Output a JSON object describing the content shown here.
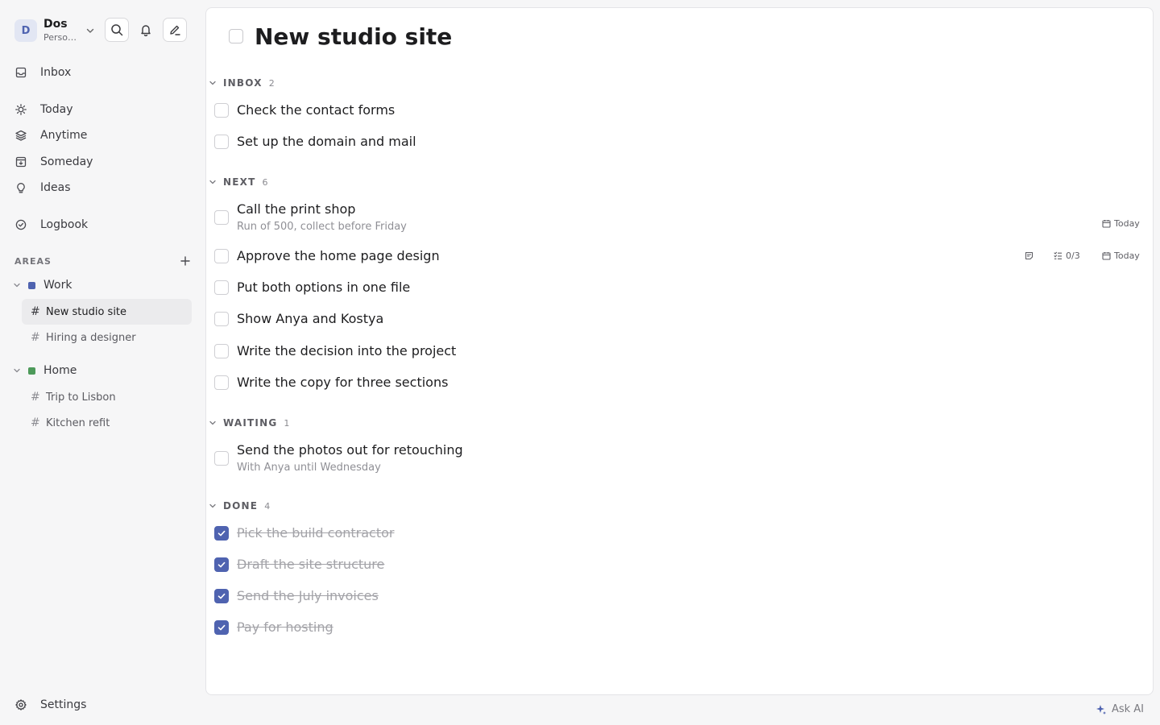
{
  "workspace": {
    "avatar_letter": "D",
    "name": "Dos",
    "subtitle": "Personal"
  },
  "sidebar": {
    "nav": [
      {
        "label": "Inbox",
        "icon": "inbox-icon"
      },
      {
        "label": "Today",
        "icon": "sun-icon"
      },
      {
        "label": "Anytime",
        "icon": "layers-icon"
      },
      {
        "label": "Someday",
        "icon": "archive-box-icon"
      },
      {
        "label": "Ideas",
        "icon": "lightbulb-icon"
      },
      {
        "label": "Logbook",
        "icon": "check-circle-icon"
      }
    ],
    "areas_label": "AREAS",
    "areas": [
      {
        "label": "Work",
        "color": "#4f63b0",
        "projects": [
          {
            "label": "New studio site",
            "active": true
          },
          {
            "label": "Hiring a designer"
          }
        ]
      },
      {
        "label": "Home",
        "color": "#4d9a5a",
        "projects": [
          {
            "label": "Trip to Lisbon"
          },
          {
            "label": "Kitchen refit"
          }
        ]
      }
    ],
    "settings_label": "Settings"
  },
  "main": {
    "title": "New studio site",
    "sections": [
      {
        "label": "INBOX",
        "count": "2",
        "tasks": [
          {
            "title": "Check the contact forms"
          },
          {
            "title": "Set up the domain and mail"
          }
        ]
      },
      {
        "label": "NEXT",
        "count": "6",
        "tasks": [
          {
            "title": "Call the print shop",
            "note": "Run of 500, collect before Friday",
            "date": "Today"
          },
          {
            "title": "Approve the home page design",
            "checklist": "0/3",
            "date": "Today"
          },
          {
            "title": "Put both options in one file"
          },
          {
            "title": "Show Anya and Kostya"
          },
          {
            "title": "Write the decision into the project"
          },
          {
            "title": "Write the copy for three sections"
          }
        ]
      },
      {
        "label": "WAITING",
        "count": "1",
        "tasks": [
          {
            "title": "Send the photos out for retouching",
            "note": "With Anya until Wednesday"
          }
        ]
      },
      {
        "label": "DONE",
        "count": "4",
        "tasks": [
          {
            "title": "Pick the build contractor",
            "done": true
          },
          {
            "title": "Draft the site structure",
            "done": true
          },
          {
            "title": "Send the July invoices",
            "done": true
          },
          {
            "title": "Pay for hosting",
            "done": true
          }
        ]
      }
    ]
  },
  "ask_ai_label": "Ask AI",
  "colors": {
    "accent": "#4f63b0",
    "work": "#4f63b0",
    "home": "#4d9a5a"
  }
}
